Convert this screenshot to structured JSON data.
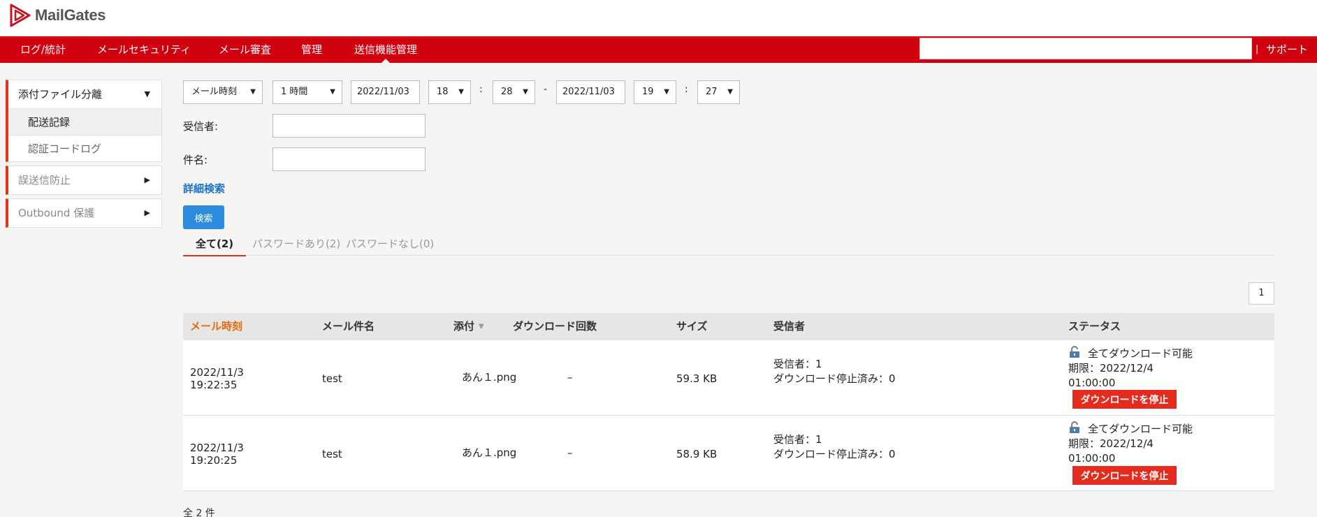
{
  "app": {
    "title": "MailGates"
  },
  "nav": {
    "items": [
      "ログ/統計",
      "メールセキュリティ",
      "メール審査",
      "管理",
      "送信機能管理"
    ],
    "active_index": 4,
    "separator": "|",
    "support": "サポート"
  },
  "sidebar": {
    "groups": [
      {
        "label": "添付ファイル分離",
        "caret": "▼",
        "items": [
          {
            "label": "配送記録",
            "active": true
          },
          {
            "label": "認証コードログ",
            "active": false
          }
        ]
      },
      {
        "label": "誤送信防止",
        "caret": "▶"
      },
      {
        "label": "Outbound 保護",
        "caret": "▶"
      }
    ]
  },
  "filter": {
    "time_type": "メール時刻",
    "range": "1 時間",
    "start_date": "2022/11/03",
    "start_hour": "18",
    "start_min": "28",
    "dash": "-",
    "colon": ":",
    "end_date": "2022/11/03",
    "end_hour": "19",
    "end_min": "27",
    "recipient_label": "受信者:",
    "subject_label": "件名:",
    "advanced_link": "詳細検索",
    "search_button": "検索"
  },
  "tabs": [
    "全て(2)",
    "パスワードあり(2)",
    "パスワードなし(0)"
  ],
  "pagination": {
    "page": "1"
  },
  "table": {
    "headers": [
      "メール時刻",
      "メール件名",
      "添付",
      "ダウンロード回数",
      "サイズ",
      "受信者",
      "ステータス"
    ],
    "sort_indicator": "▼",
    "rows": [
      {
        "time_date": "2022/11/3",
        "time_clock": "19:22:35",
        "subject": "test",
        "attachment": "あん１.png",
        "downloads": "–",
        "size": "59.3 KB",
        "recipients": "受信者：1",
        "stopped": "ダウンロード停止済み：0",
        "status": "全てダウンロード可能",
        "expiry": "期限：2022/12/4",
        "expiry_time": "01:00:00",
        "action": "ダウンロードを停止"
      },
      {
        "time_date": "2022/11/3",
        "time_clock": "19:20:25",
        "subject": "test",
        "attachment": "あん１.png",
        "downloads": "–",
        "size": "58.9 KB",
        "recipients": "受信者：1",
        "stopped": "ダウンロード停止済み：0",
        "status": "全てダウンロード可能",
        "expiry": "期限：2022/12/4",
        "expiry_time": "01:00:00",
        "action": "ダウンロードを停止"
      }
    ]
  },
  "footer": {
    "total": "全 2 件"
  },
  "colors": {
    "brand_red": "#d0000f",
    "accent_red": "#e0341f",
    "sorted_header": "#e46a10",
    "search_blue": "#2c8bdc",
    "link_blue": "#1a73c8"
  }
}
